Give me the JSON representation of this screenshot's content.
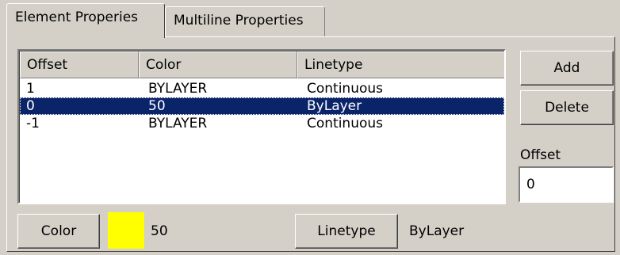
{
  "tabs": [
    {
      "label": "Element Properies"
    },
    {
      "label": "Multiline Properties"
    }
  ],
  "listview": {
    "columns": [
      "Offset",
      "Color",
      "Linetype"
    ],
    "rows": [
      {
        "offset": "1",
        "color": "BYLAYER",
        "linetype": "Continuous"
      },
      {
        "offset": "0",
        "color": "50",
        "linetype": "ByLayer"
      },
      {
        "offset": "-1",
        "color": "BYLAYER",
        "linetype": "Continuous"
      }
    ],
    "selected_row": 1
  },
  "buttons": {
    "add": "Add",
    "delete": "Delete",
    "color": "Color",
    "linetype": "Linetype"
  },
  "offset": {
    "label": "Offset",
    "value": "0"
  },
  "color_display": {
    "swatch_color": "#ffff00",
    "value": "50"
  },
  "linetype_display": {
    "value": "ByLayer"
  },
  "colors": {
    "selection": "#0a246a",
    "face": "#d4d0c8"
  }
}
